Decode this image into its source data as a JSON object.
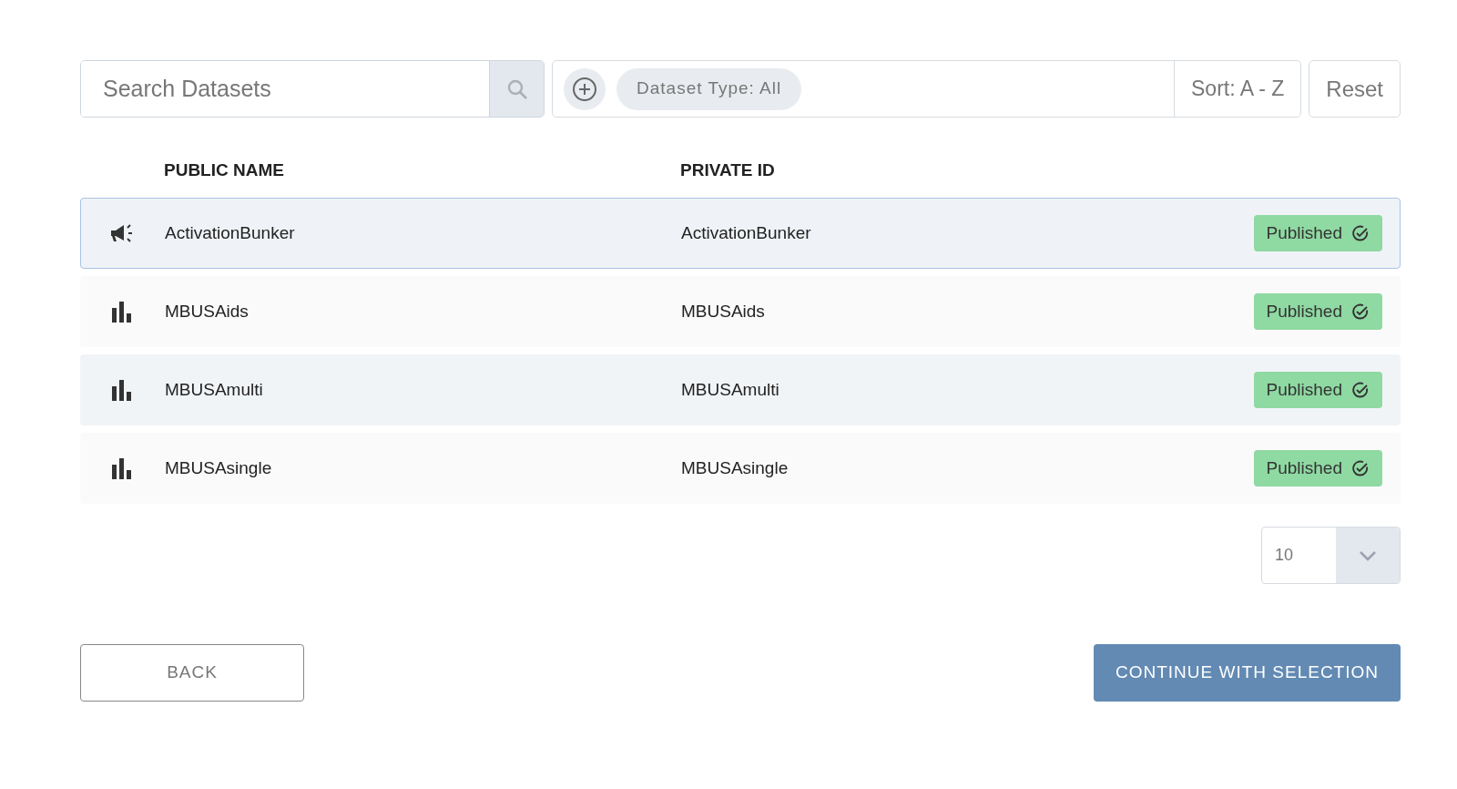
{
  "search": {
    "placeholder": "Search Datasets"
  },
  "filters": [
    {
      "label": "Dataset Type: All"
    }
  ],
  "sort": "Sort: A - Z",
  "reset": "Reset",
  "table": {
    "columns": [
      "PUBLIC NAME",
      "PRIVATE ID"
    ],
    "rows": [
      {
        "kind": "megaphone",
        "public_name": "ActivationBunker",
        "private_id": "ActivationBunker",
        "status": "Published",
        "selected": true
      },
      {
        "kind": "chart",
        "public_name": "MBUSAids",
        "private_id": "MBUSAids",
        "status": "Published",
        "selected": false
      },
      {
        "kind": "chart",
        "public_name": "MBUSAmulti",
        "private_id": "MBUSAmulti",
        "status": "Published",
        "selected": false
      },
      {
        "kind": "chart",
        "public_name": "MBUSAsingle",
        "private_id": "MBUSAsingle",
        "status": "Published",
        "selected": false
      }
    ]
  },
  "page_size": "10",
  "back": "BACK",
  "continue": "CONTINUE WITH SELECTION"
}
